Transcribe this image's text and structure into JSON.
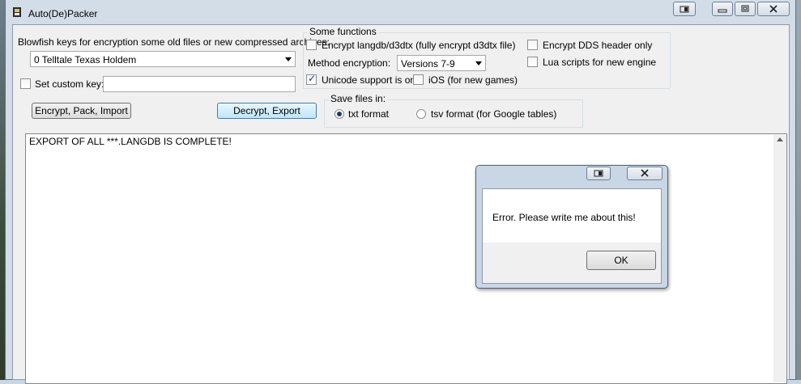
{
  "window": {
    "title": "Auto(De)Packer"
  },
  "keys_section": {
    "label": "Blowfish keys for encryption some old files or new compressed archives:",
    "selected_key": "0 Telltale Texas Holdem",
    "custom_key_label": "Set custom key:",
    "custom_key_value": "",
    "custom_key_checked": false
  },
  "functions": {
    "group_label": "Some functions",
    "encrypt_langdb_label": "Encrypt langdb/d3dtx (fully encrypt d3dtx file)",
    "encrypt_langdb_checked": false,
    "encrypt_dds_label": "Encrypt DDS header only",
    "encrypt_dds_checked": false,
    "method_label": "Method encryption:",
    "method_value": "Versions 7-9",
    "lua_label": "Lua scripts for new engine",
    "lua_checked": false,
    "unicode_label": "Unicode support is on.",
    "unicode_checked": true,
    "ios_label": "iOS (for new games)",
    "ios_checked": false
  },
  "buttons": {
    "encrypt_pack_import": "Encrypt, Pack, Import",
    "decrypt_export": "Decrypt, Export"
  },
  "save_files": {
    "group_label": "Save files in:",
    "txt_label": "txt format",
    "tsv_label": "tsv format (for Google tables)",
    "selected": "txt"
  },
  "log": {
    "text": "EXPORT OF ALL ***.LANGDB IS COMPLETE!"
  },
  "dialog": {
    "message": "Error. Please write me about this!",
    "ok_label": "OK"
  }
}
